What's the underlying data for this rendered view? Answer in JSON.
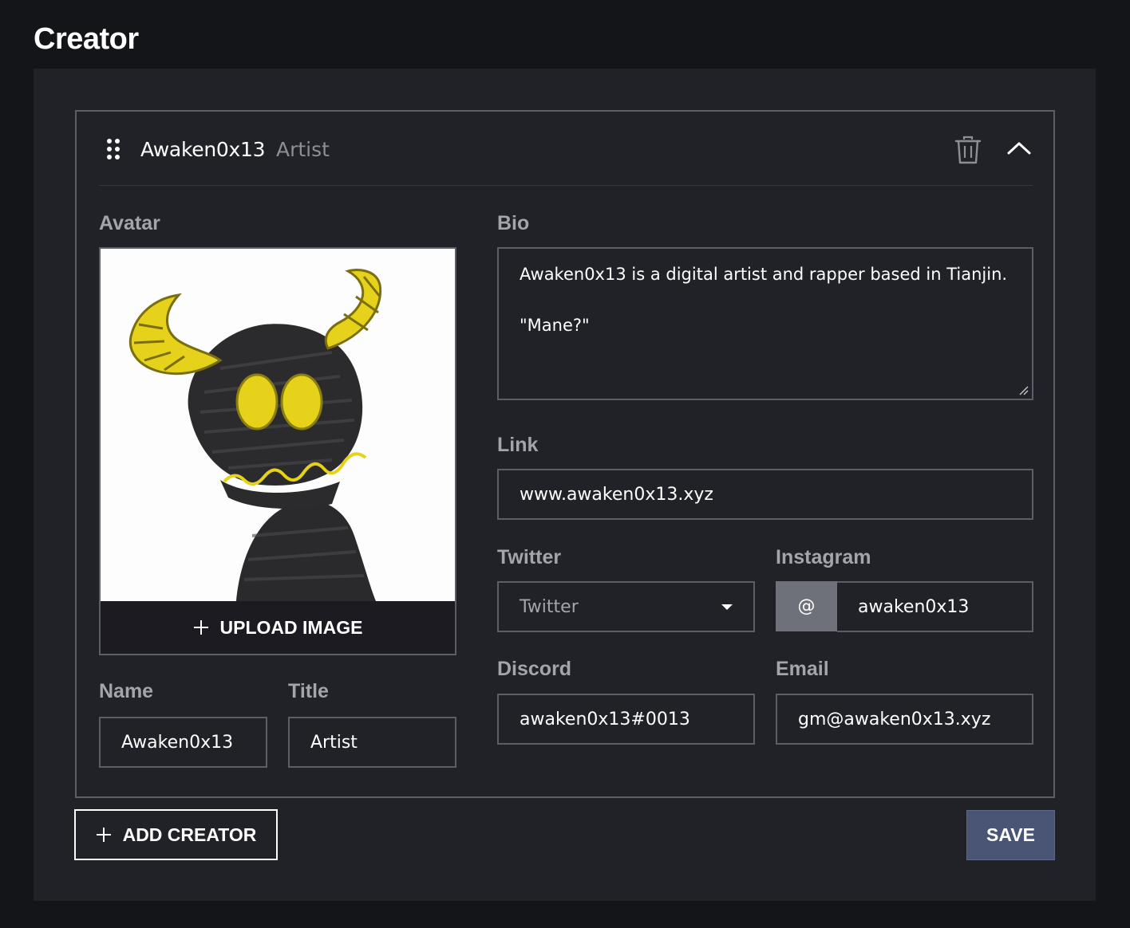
{
  "page": {
    "title": "Creator"
  },
  "creator": {
    "header": {
      "name": "Awaken0x13",
      "title": "Artist"
    },
    "avatar": {
      "label": "Avatar",
      "upload_label": "UPLOAD IMAGE"
    },
    "name": {
      "label": "Name",
      "value": "Awaken0x13"
    },
    "title": {
      "label": "Title",
      "value": "Artist"
    },
    "bio": {
      "label": "Bio",
      "line1": "Awaken0x13 is a digital artist and rapper based in Tianjin.",
      "line2": "\"Mane?\""
    },
    "link": {
      "label": "Link",
      "value": "www.awaken0x13.xyz"
    },
    "twitter": {
      "label": "Twitter",
      "placeholder": "Twitter"
    },
    "instagram": {
      "label": "Instagram",
      "prefix": "@",
      "value": "awaken0x13"
    },
    "discord": {
      "label": "Discord",
      "value": "awaken0x13#0013"
    },
    "email": {
      "label": "Email",
      "value": "gm@awaken0x13.xyz"
    }
  },
  "actions": {
    "add_label": "ADD CREATOR",
    "save_label": "SAVE"
  },
  "colors": {
    "background": "#141518",
    "panel": "#202227",
    "border": "#5b5e66",
    "label": "#a2a5ab",
    "save_button": "#4a5575",
    "horn_yellow": "#e6d21a"
  }
}
